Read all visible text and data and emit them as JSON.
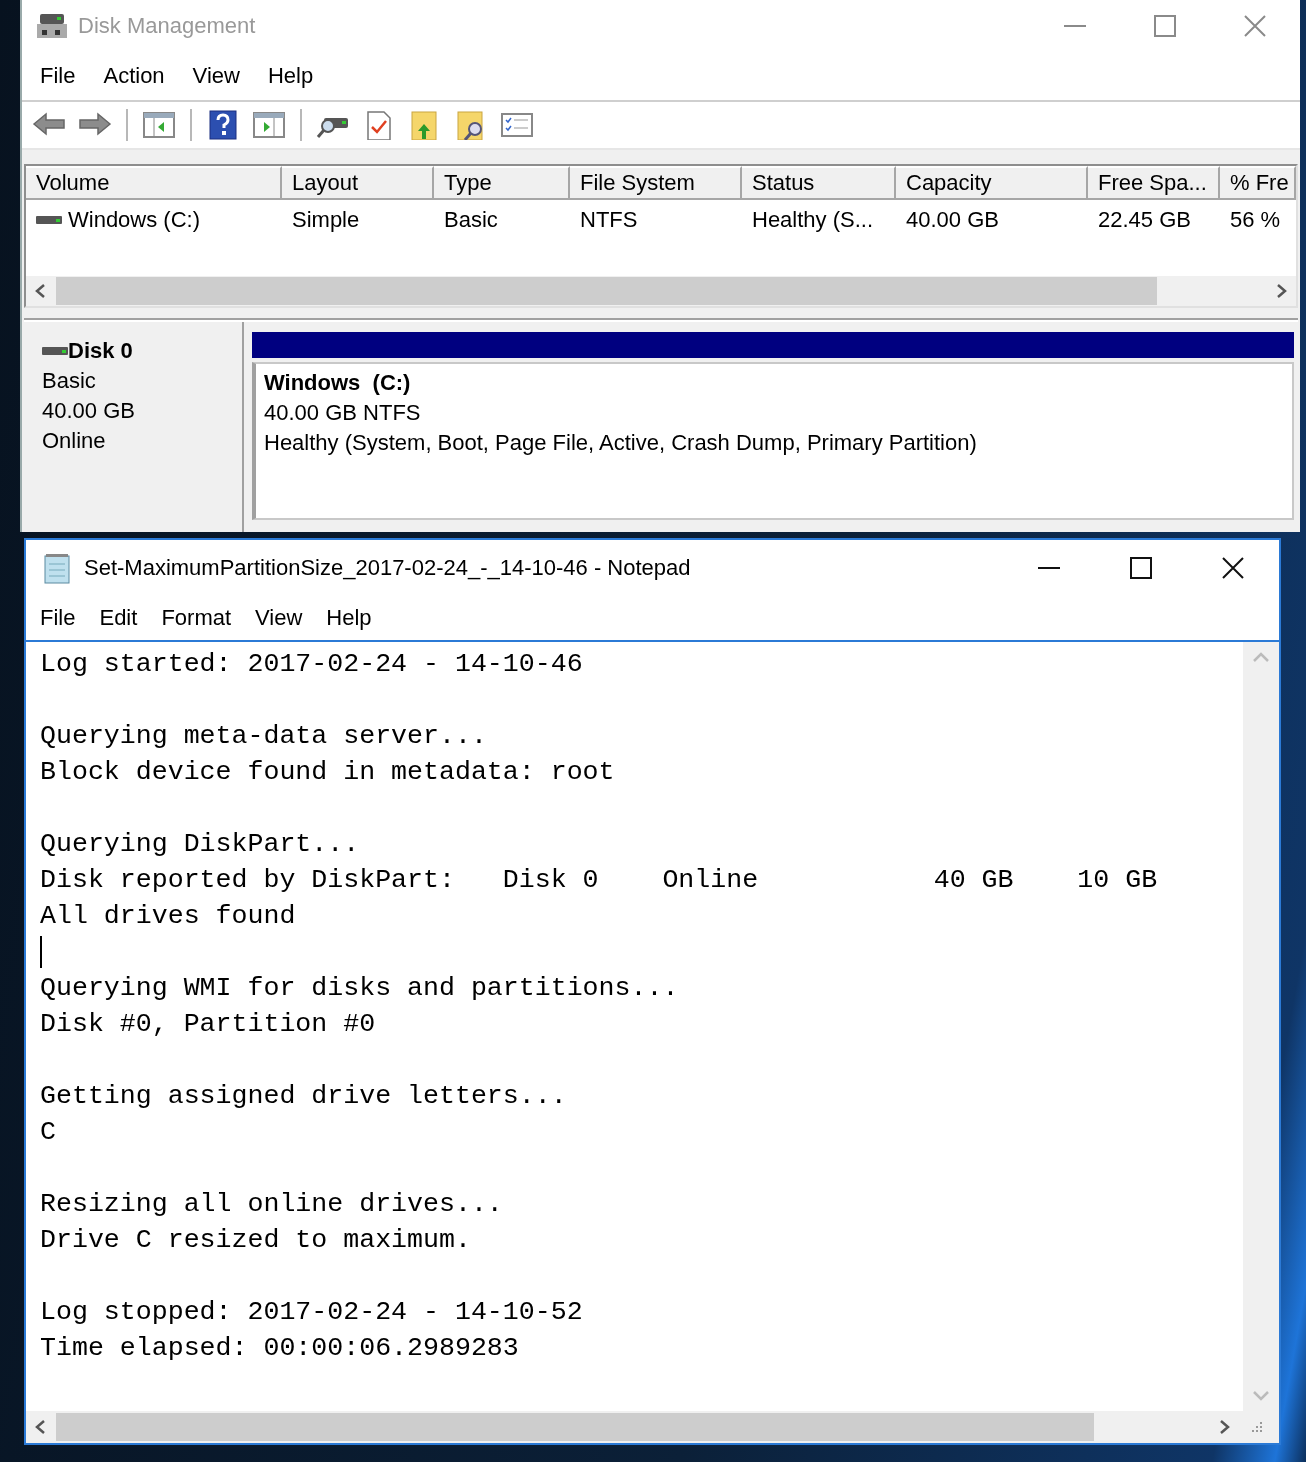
{
  "disk_management": {
    "title": "Disk Management",
    "active": false,
    "menu": [
      "File",
      "Action",
      "View",
      "Help"
    ],
    "volume_table": {
      "columns": [
        "Volume",
        "Layout",
        "Type",
        "File System",
        "Status",
        "Capacity",
        "Free Spa...",
        "% Fre"
      ],
      "rows": [
        {
          "cells": [
            "Windows (C:)",
            "Simple",
            "Basic",
            "NTFS",
            "Healthy (S...",
            "40.00 GB",
            "22.45 GB",
            "56 %"
          ]
        }
      ]
    },
    "disk": {
      "name": "Disk 0",
      "type": "Basic",
      "size": "40.00 GB",
      "status": "Online"
    },
    "partition": {
      "name": "Windows  (C:)",
      "size": "40.00 GB NTFS",
      "status": "Healthy (System, Boot, Page File, Active, Crash Dump, Primary Partition)"
    }
  },
  "notepad": {
    "title": "Set-MaximumPartitionSize_2017-02-24_-_14-10-46 - Notepad",
    "active": true,
    "menu": [
      "File",
      "Edit",
      "Format",
      "View",
      "Help"
    ],
    "paragraphs": [
      {
        "lines": [
          "Log started: 2017-02-24 - 14-10-46"
        ],
        "caret_below": false
      },
      {
        "lines": [
          "Querying meta-data server...",
          "Block device found in metadata: root"
        ],
        "caret_below": false
      },
      {
        "lines": [
          "Querying DiskPart...",
          "Disk reported by DiskPart:   Disk 0    Online           40 GB    10 GB",
          "All drives found"
        ],
        "caret_below": true
      },
      {
        "lines": [
          "Querying WMI for disks and partitions...",
          "Disk #0, Partition #0"
        ],
        "caret_below": false
      },
      {
        "lines": [
          "Getting assigned drive letters...",
          "C"
        ],
        "caret_below": false
      },
      {
        "lines": [
          "Resizing all online drives...",
          "Drive C resized to maximum."
        ],
        "caret_below": false
      },
      {
        "lines": [
          "Log stopped: 2017-02-24 - 14-10-52",
          "Time elapsed: 00:00:06.2989283"
        ],
        "caret_below": false
      }
    ]
  }
}
